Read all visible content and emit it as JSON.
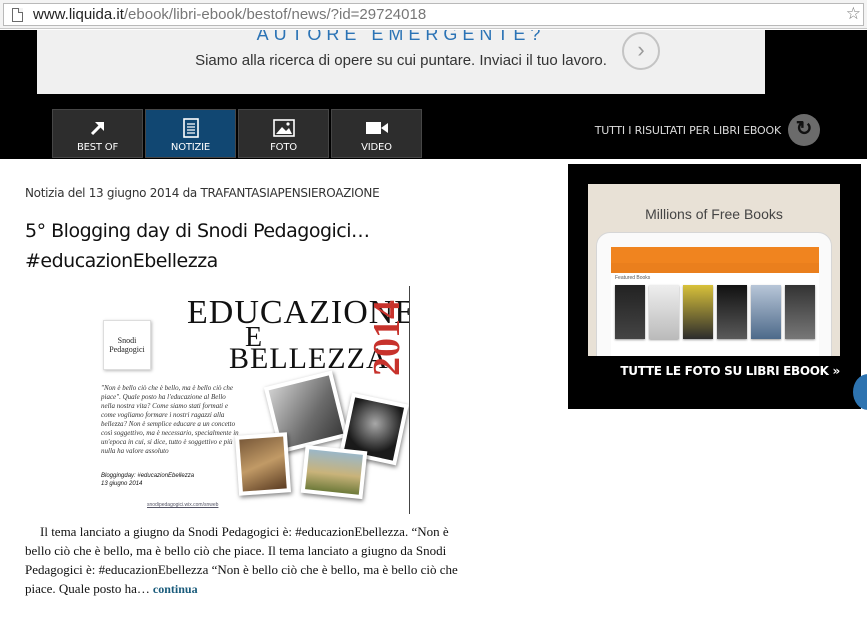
{
  "browser": {
    "url_host": "www.liquida.it",
    "url_path": "/ebook/libri-ebook/bestof/news/?id=29724018"
  },
  "banner": {
    "headline": "AUTORE EMERGENTE?",
    "text": "Siamo alla ricerca di opere su cui puntare. Inviaci il tuo lavoro."
  },
  "tabs": [
    {
      "label": "BEST OF",
      "icon": "arrow-up-right-icon"
    },
    {
      "label": "NOTIZIE",
      "icon": "document-icon",
      "active": true
    },
    {
      "label": "FOTO",
      "icon": "image-icon"
    },
    {
      "label": "VIDEO",
      "icon": "video-camera-icon"
    }
  ],
  "all_results": "TUTTI I RISULTATI PER LIBRI EBOOK",
  "article": {
    "meta": "Notizia del 13 giugno 2014 da TRAFANTASIAPENSIEROAZIONE",
    "title": "5° Blogging day di Snodi Pedagogici… #educazionEbellezza",
    "image": {
      "line1": "EDUCAZIONE",
      "line2": "E",
      "line3": "BELLEZZA",
      "year": "2014",
      "logo": "Snodi Pedagogici",
      "quote": "\"Non è bello ciò che è bello, ma è bello ciò che piace\". Quale posto ha l'educazione al Bello nella nostra vita? Come siamo stati formati e come vogliamo formare i nostri ragazzi alla bellezza? Non è semplice educare a un concetto così soggettivo, ma è necessario, specialmente in un'epoca in cui, si dice, tutto è soggettivo e più nulla ha valore assoluto",
      "tag": "Bloggingday: #educazionEbellezza",
      "date": "13 giugno 2014",
      "site": "snodipedagogici.wix.com/snweb"
    },
    "excerpt": "Il tema lanciato a giugno da Snodi Pedagogici è: #educazionEbellezza. “Non è bello ciò che è bello, ma è bello ciò che piace.     Il tema lanciato a giugno da Snodi Pedagogici è: #educazionEbellezza “Non è bello ciò che è bello, ma è bello ciò che piace. Quale posto ha…",
    "continue_label": "continua"
  },
  "photo_box": {
    "caption": "Millions of Free Books",
    "link": "TUTTE LE FOTO SU LIBRI EBOOK »",
    "screen_label": "Featured Books"
  },
  "colors": {
    "active_tab": "#114772",
    "tab": "#2d2d2d",
    "banner_headline": "#2b73b5",
    "link": "#185a7a",
    "year_red": "#c7322c"
  }
}
